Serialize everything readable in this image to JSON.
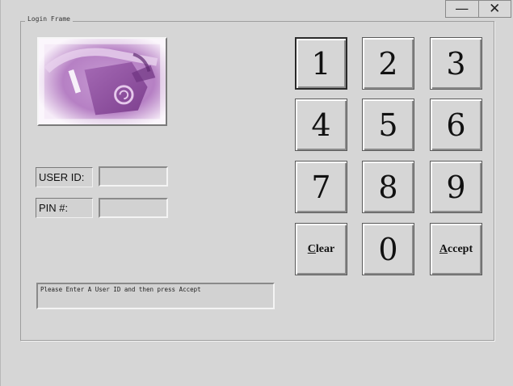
{
  "window": {
    "controls": {
      "minimize": "—",
      "close": "✕"
    }
  },
  "frame": {
    "title": "Login Frame"
  },
  "logo": {
    "icon": "credit-card-in-slot-icon",
    "tint": "#b680c4"
  },
  "form": {
    "user_id_label": "USER ID:",
    "user_id_value": "",
    "pin_label": "PIN #:",
    "pin_value": ""
  },
  "status": {
    "message": "Please Enter A User ID and then press Accept"
  },
  "keypad": {
    "keys": [
      "1",
      "2",
      "3",
      "4",
      "5",
      "6",
      "7",
      "8",
      "9"
    ],
    "clear_mnemonic": "C",
    "clear_rest": "lear",
    "zero": "0",
    "accept_mnemonic": "A",
    "accept_rest": "ccept"
  }
}
